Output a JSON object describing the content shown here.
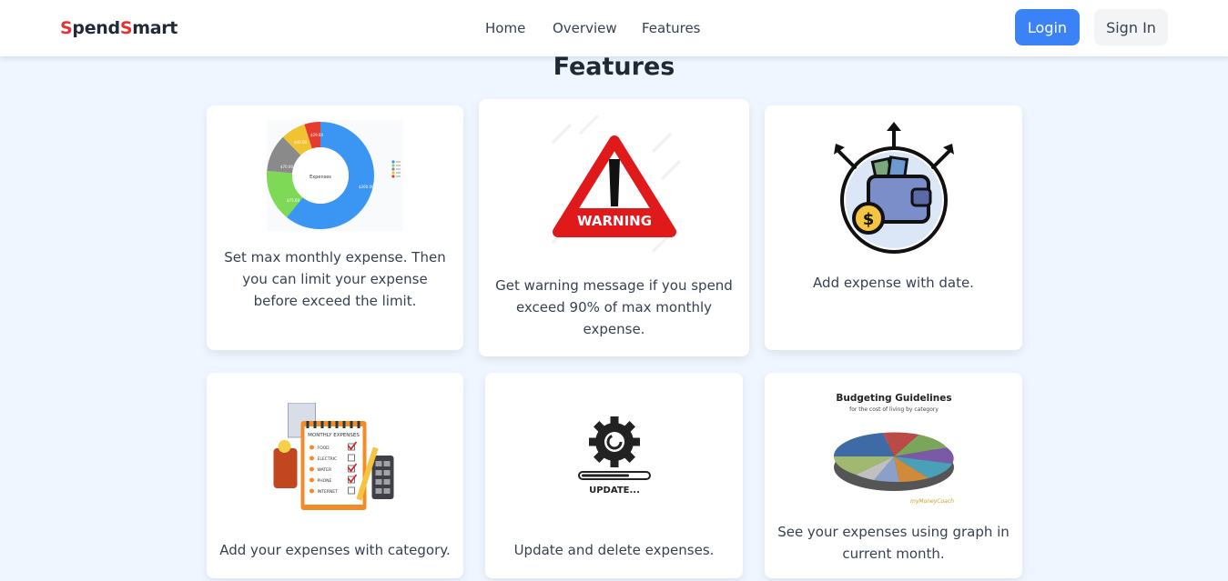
{
  "brand": {
    "part1_initial": "S",
    "part1_rest": "pend",
    "part2_initial": "S",
    "part2_rest": "mart"
  },
  "nav": {
    "home": "Home",
    "overview": "Overview",
    "features": "Features"
  },
  "buttons": {
    "login": "Login",
    "signin": "Sign In"
  },
  "section_title": "Features",
  "cards": [
    {
      "text": "Set max monthly expense. Then you can limit your expense before exceed the limit.",
      "image": "donut-chart-image",
      "chart": {
        "center": "Expenses",
        "labels": [
          "$260.00",
          "$75.00",
          "$70.00",
          "$40.00",
          "$29.00"
        ]
      }
    },
    {
      "text": "Get warning message if you spend exceed 90% of max monthly expense.",
      "image": "warning-sign-image",
      "sign": "WARNING"
    },
    {
      "text": "Add expense with date.",
      "image": "wallet-dollar-icon"
    },
    {
      "text": "Add your expenses with category.",
      "image": "monthly-expenses-clipboard-image",
      "list_title": "MONTHLY EXPENSES",
      "list_items": [
        "FOOD",
        "ELECTRIC",
        "WATER",
        "PHONE",
        "INTERNET"
      ]
    },
    {
      "text": "Update and delete expenses.",
      "image": "gear-update-icon",
      "caption": "UPDATE..."
    },
    {
      "text": "See your expenses using graph in current month.",
      "image": "budget-pie-chart-image",
      "title": "Budgeting Guidelines",
      "subtitle": "for the cost of living by category"
    }
  ],
  "colors": {
    "accent": "#3b82f6",
    "brand_red": "#e3342f",
    "background": "#eff6ff"
  }
}
